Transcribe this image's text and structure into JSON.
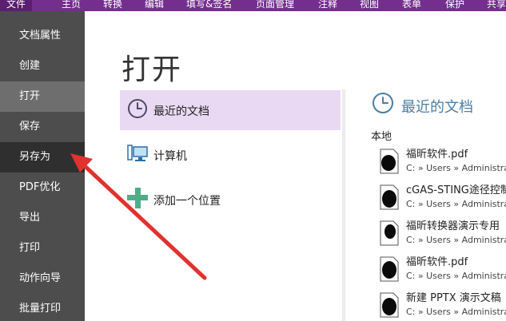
{
  "ribbon": {
    "tabs": [
      "文件",
      "主页",
      "转换",
      "编辑",
      "填写&签名",
      "页面管理",
      "注释",
      "视图",
      "表单",
      "保护",
      "共享"
    ]
  },
  "sidebar": {
    "items": [
      "文档属性",
      "创建",
      "打开",
      "保存",
      "另存为",
      "PDF优化",
      "导出",
      "打印",
      "动作向导",
      "批量打印"
    ]
  },
  "main": {
    "title": "打开",
    "locations": [
      "最近的文档",
      "计算机",
      "添加一个位置"
    ]
  },
  "recent": {
    "title": "最近的文档",
    "section": "本地",
    "files": [
      {
        "name": "福昕软件.pdf",
        "path": "C: » Users » Administrator"
      },
      {
        "name": "cGAS-STING途径控制",
        "path": "C: » Users » Administrator"
      },
      {
        "name": "福昕转换器演示专用",
        "path": "C: » Users » Administrator"
      },
      {
        "name": "福昕软件.pdf",
        "path": "C: » Users » Administrator"
      },
      {
        "name": "新建 PPTX 演示文稿",
        "path": "C: » Users » Administrator"
      }
    ]
  },
  "colors": {
    "ribbon": "#732e8e",
    "sidebar": "#4d4d4d",
    "selected": "#ead9f2",
    "accent": "#4a7fa6",
    "arrow": "#e0322e"
  }
}
